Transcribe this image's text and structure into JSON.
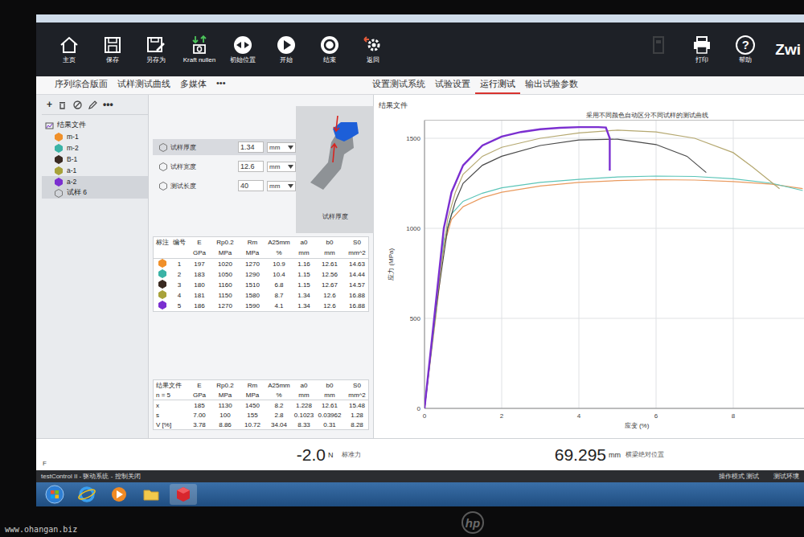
{
  "toolbar": {
    "buttons": [
      {
        "label": "主页",
        "kind": "home"
      },
      {
        "label": "保存",
        "kind": "save"
      },
      {
        "label": "另存为",
        "kind": "save-as"
      },
      {
        "label": "Kraft nullen",
        "kind": "zero-force"
      },
      {
        "label": "初始位置",
        "kind": "home-position"
      },
      {
        "label": "开始",
        "kind": "start"
      },
      {
        "label": "结束",
        "kind": "stop"
      },
      {
        "label": "返回",
        "kind": "return"
      }
    ],
    "right_buttons": [
      {
        "kind": "exit",
        "disabled": true
      },
      {
        "label": "打印",
        "kind": "print",
        "disabled": false
      },
      {
        "label": "帮助",
        "kind": "help",
        "glyph": "?",
        "disabled": false
      }
    ],
    "logo": "Zwi"
  },
  "tabs": {
    "left": [
      {
        "label": "序列综合版面",
        "selected": false
      },
      {
        "label": "试样测试曲线",
        "selected": false
      },
      {
        "label": "多媒体",
        "selected": false
      },
      {
        "label": "•••",
        "selected": false
      }
    ],
    "right": [
      {
        "label": "设置测试系统",
        "selected": false
      },
      {
        "label": "试验设置",
        "selected": false
      },
      {
        "label": "运行测试",
        "selected": true
      },
      {
        "label": "输出试验参数",
        "selected": false
      }
    ]
  },
  "tree": {
    "tools": [
      {
        "kind": "glyph",
        "glyph": "+"
      },
      {
        "kind": "delete"
      },
      {
        "kind": "block"
      },
      {
        "kind": "edit"
      },
      {
        "kind": "glyph",
        "glyph": "•••"
      }
    ],
    "items": [
      {
        "label": "结果文件",
        "kind": "root",
        "selected": false
      },
      {
        "label": "m-1",
        "kind": "specimen",
        "color": "#f0902a",
        "selected": false
      },
      {
        "label": "m-2",
        "kind": "specimen",
        "color": "#3bb3a6",
        "selected": false
      },
      {
        "label": "B-1",
        "kind": "specimen",
        "color": "#3a2a22",
        "selected": false
      },
      {
        "label": "a-1",
        "kind": "specimen",
        "color": "#a8a23a",
        "selected": false
      },
      {
        "label": "a-2",
        "kind": "specimen",
        "color": "#7b2fd0",
        "selected": true
      },
      {
        "label": "试样 6",
        "kind": "new",
        "selected": true
      }
    ]
  },
  "params": [
    {
      "label": "试样厚度",
      "value": "1.34",
      "unit": "mm",
      "selected": true
    },
    {
      "label": "试样宽度",
      "value": "12.6",
      "unit": "mm",
      "selected": false
    },
    {
      "label": "测试长度",
      "value": "40",
      "unit": "mm",
      "selected": false
    }
  ],
  "figure": {
    "caption": "试样厚度"
  },
  "results": {
    "columns": [
      {
        "name": "标注",
        "unit": ""
      },
      {
        "name": "编号",
        "unit": ""
      },
      {
        "name": "E",
        "unit": "GPa"
      },
      {
        "name": "Rp0.2",
        "unit": "MPa"
      },
      {
        "name": "Rm",
        "unit": "MPa"
      },
      {
        "name": "A25mm",
        "unit": "%"
      },
      {
        "name": "a0",
        "unit": "mm"
      },
      {
        "name": "b0",
        "unit": "mm"
      },
      {
        "name": "S0",
        "unit": "mm^2"
      }
    ],
    "rows": [
      {
        "color": "#f0902a",
        "id": "1",
        "cells": [
          "197",
          "1020",
          "1270",
          "10.9",
          "1.16",
          "12.61",
          "14.63"
        ]
      },
      {
        "color": "#3bb3a6",
        "id": "2",
        "cells": [
          "183",
          "1050",
          "1290",
          "10.4",
          "1.15",
          "12.56",
          "14.44"
        ]
      },
      {
        "color": "#3a2a22",
        "id": "3",
        "cells": [
          "180",
          "1160",
          "1510",
          "6.8",
          "1.15",
          "12.67",
          "14.57"
        ]
      },
      {
        "color": "#a8a23a",
        "id": "4",
        "cells": [
          "181",
          "1150",
          "1580",
          "8.7",
          "1.34",
          "12.6",
          "16.88"
        ]
      },
      {
        "color": "#7b2fd0",
        "id": "5",
        "cells": [
          "186",
          "1270",
          "1590",
          "4.1",
          "1.34",
          "12.6",
          "16.88"
        ]
      }
    ]
  },
  "stats": {
    "title": "结果文件",
    "count": "n = 5",
    "columns": [
      {
        "name": "E",
        "unit": "GPa"
      },
      {
        "name": "Rp0.2",
        "unit": "MPa"
      },
      {
        "name": "Rm",
        "unit": "MPa"
      },
      {
        "name": "A25mm",
        "unit": "%"
      },
      {
        "name": "a0",
        "unit": "mm"
      },
      {
        "name": "b0",
        "unit": "mm"
      },
      {
        "name": "S0",
        "unit": "mm^2"
      }
    ],
    "rows": [
      {
        "label": "x",
        "cells": [
          "185",
          "1130",
          "1450",
          "8.2",
          "1.228",
          "12.61",
          "15.48"
        ]
      },
      {
        "label": "s",
        "cells": [
          "7.00",
          "100",
          "155",
          "2.8",
          "0.1023",
          "0.03962",
          "1.28"
        ]
      },
      {
        "label": "V [%]",
        "cells": [
          "3.78",
          "8.86",
          "10.72",
          "34.04",
          "8.33",
          "0.31",
          "8.28"
        ]
      }
    ]
  },
  "chart": {
    "title": "结果文件",
    "caption": "采用不同颜色自动区分不同试样的测试曲线",
    "y_label": "应力 (MPa)",
    "x_label": "应变 (%)",
    "y_ticks": [
      "0",
      "500",
      "1000",
      "1500"
    ],
    "x_ticks": [
      "0",
      "2",
      "4",
      "6",
      "8"
    ],
    "series": [
      {
        "name": "m-1",
        "color": "#e99a5e",
        "strain": [
          0,
          0.3,
          0.5,
          0.7,
          1,
          1.5,
          2,
          3,
          4,
          5,
          6,
          7,
          8,
          9,
          9.8
        ],
        "stress": [
          0,
          520,
          900,
          1050,
          1120,
          1170,
          1200,
          1235,
          1255,
          1265,
          1270,
          1268,
          1260,
          1245,
          1220
        ]
      },
      {
        "name": "m-2",
        "color": "#5cc5b8",
        "strain": [
          0,
          0.3,
          0.5,
          0.7,
          1,
          1.5,
          2,
          3,
          4,
          5,
          6,
          7,
          8,
          9,
          9.8
        ],
        "stress": [
          0,
          540,
          930,
          1080,
          1150,
          1195,
          1225,
          1255,
          1272,
          1285,
          1290,
          1288,
          1275,
          1250,
          1210
        ]
      },
      {
        "name": "B-1",
        "color": "#4a4a4a",
        "strain": [
          0,
          0.3,
          0.6,
          0.8,
          1,
          1.5,
          2,
          3,
          4,
          5,
          6,
          6.8,
          7.3
        ],
        "stress": [
          0,
          560,
          1000,
          1150,
          1250,
          1350,
          1400,
          1460,
          1490,
          1495,
          1465,
          1400,
          1310
        ]
      },
      {
        "name": "a-1",
        "color": "#b5a870",
        "strain": [
          0,
          0.3,
          0.6,
          0.8,
          1,
          1.5,
          2,
          3,
          4,
          5,
          6,
          7,
          8,
          8.5,
          9.2
        ],
        "stress": [
          0,
          580,
          1050,
          1200,
          1300,
          1400,
          1450,
          1500,
          1530,
          1545,
          1535,
          1500,
          1420,
          1340,
          1220
        ]
      },
      {
        "name": "a-2",
        "color": "#7b2fd0",
        "strain": [
          0,
          0.3,
          0.5,
          0.7,
          1,
          1.5,
          2,
          2.5,
          3,
          3.5,
          4,
          4.5,
          4.7,
          4.8,
          4.8
        ],
        "stress": [
          0,
          600,
          1000,
          1200,
          1350,
          1460,
          1510,
          1535,
          1550,
          1558,
          1562,
          1562,
          1560,
          1500,
          1320
        ]
      }
    ]
  },
  "status": {
    "axis": "F",
    "force": {
      "value": "-2.0",
      "unit": "N",
      "label": "标准力"
    },
    "position": {
      "value": "69.295",
      "unit": "mm",
      "label": "横梁绝对位置"
    }
  },
  "control_bar": {
    "text": "testControl II - 驱动系统 - 控制关闭",
    "right": [
      "操作模式 测试",
      "测试环境"
    ]
  },
  "taskbar": {
    "apps": [
      {
        "kind": "start",
        "active": false
      },
      {
        "kind": "ie",
        "active": false
      },
      {
        "kind": "media",
        "active": false
      },
      {
        "kind": "folder",
        "active": false
      },
      {
        "kind": "testxpert",
        "active": true
      }
    ]
  },
  "bezel": {
    "brand": "hp",
    "watermark": "www.ohangan.biz"
  }
}
